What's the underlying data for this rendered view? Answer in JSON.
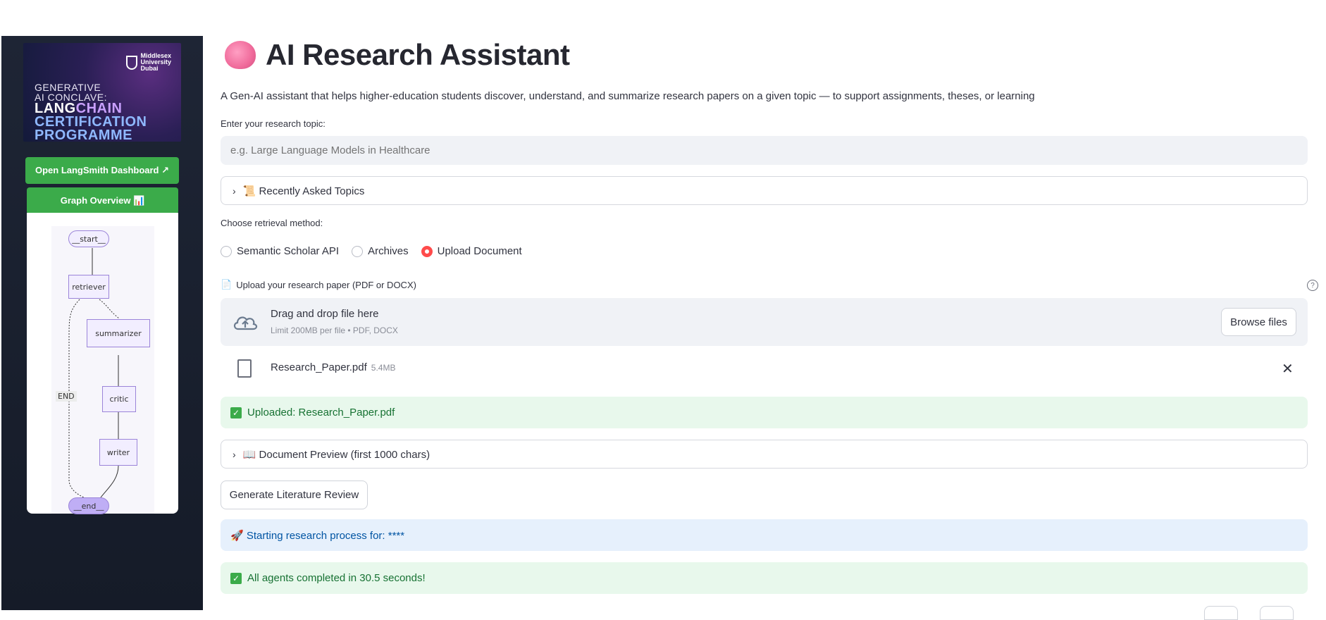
{
  "sidebar": {
    "banner": {
      "university": [
        "Middlesex",
        "University",
        "Dubai"
      ],
      "line1": "GENERATIVE",
      "line2": "AI CONCLAVE:",
      "line3a": "LANG",
      "line3b": "CHAIN",
      "line4": "CERTIFICATION",
      "line5": "PROGRAMME"
    },
    "langsmith_button": "Open LangSmith Dashboard ↗",
    "graph_button": "Graph Overview 📊",
    "graph": {
      "nodes": [
        "__start__",
        "retriever",
        "summarizer",
        "critic",
        "writer",
        "__end__"
      ],
      "end_label": "END"
    }
  },
  "main": {
    "title": "AI Research Assistant",
    "description": "A Gen-AI assistant that helps higher-education students discover, understand, and summarize research papers on a given topic — to support assignments, theses, or learning",
    "topic_label": "Enter your research topic:",
    "topic_placeholder": "e.g. Large Language Models in Healthcare",
    "recent_expander": "📜 Recently Asked Topics",
    "retrieval_label": "Choose retrieval method:",
    "retrieval_options": [
      "Semantic Scholar API",
      "Archives",
      "Upload Document"
    ],
    "retrieval_selected": "Upload Document",
    "upload_label": "Upload your research paper (PDF or DOCX)",
    "dropzone": {
      "title": "Drag and drop file here",
      "limit": "Limit 200MB per file • PDF, DOCX",
      "browse": "Browse files"
    },
    "file": {
      "name": "Research_Paper.pdf",
      "size": "5.4MB"
    },
    "uploaded_msg": "Uploaded: Research_Paper.pdf",
    "preview_expander": "📖 Document Preview (first 1000 chars)",
    "generate_button": "Generate Literature Review",
    "starting_msg": "🚀 Starting research process for: ****",
    "completed_msg": "All agents completed in 30.5 seconds!"
  },
  "colors": {
    "accent_green": "#3bab4a",
    "radio_red": "#ff4b4b",
    "sidebar_bg": "#1e2535"
  }
}
